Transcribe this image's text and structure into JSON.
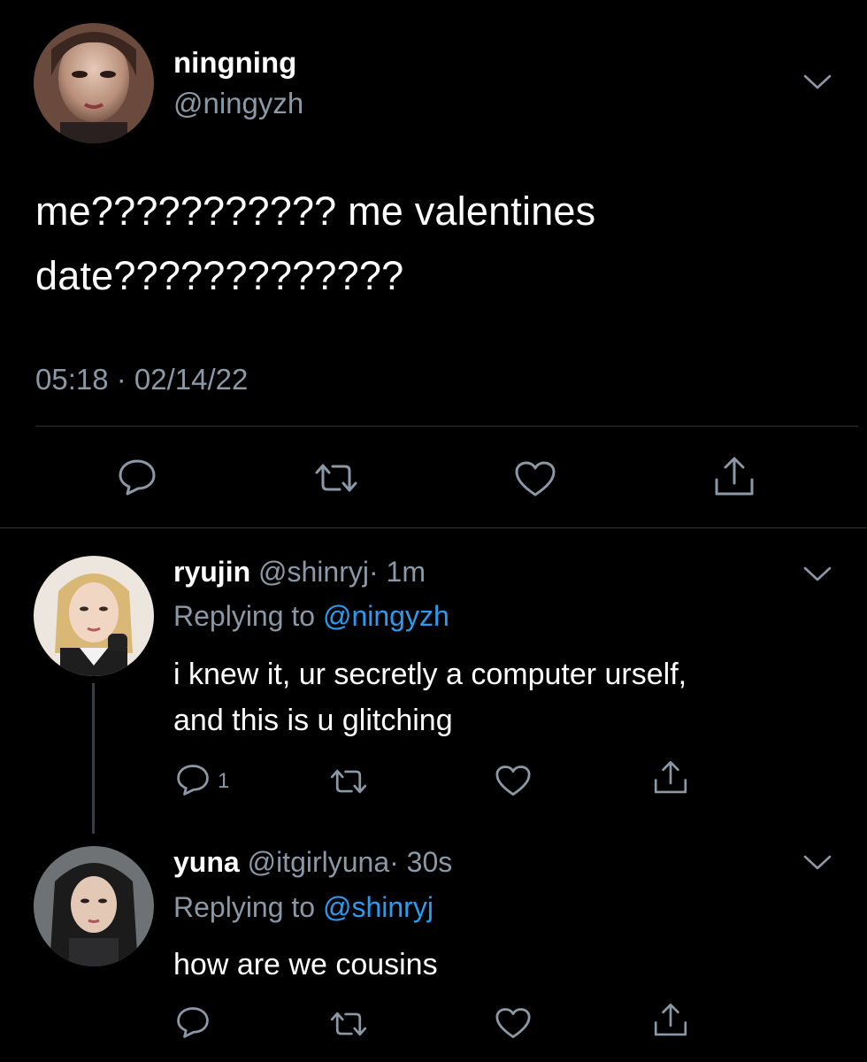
{
  "main_tweet": {
    "display_name": "ningning",
    "handle": "@ningyzh",
    "text_line1": "me??????????? me valentines",
    "text_line2": "date?????????????",
    "timestamp": "05:18 · 02/14/22"
  },
  "replies": [
    {
      "display_name": "ryujin",
      "handle": "@shinryj",
      "time": "· 1m",
      "replying_prefix": "Replying to ",
      "replying_to": "@ningyzh",
      "text_line1": "i knew it, ur secretly a computer urself,",
      "text_line2": "and this is u glitching",
      "reply_count": "1"
    },
    {
      "display_name": "yuna",
      "handle": "@itgirlyuna",
      "time": "· 30s",
      "replying_prefix": "Replying to ",
      "replying_to": "@shinryj",
      "text_line1": "how are we cousins"
    }
  ],
  "icons": {
    "reply": "speech-bubble-icon",
    "retweet": "retweet-icon",
    "like": "heart-icon",
    "share": "share-icon",
    "menu": "chevron-down-icon"
  },
  "colors": {
    "background": "#000000",
    "text": "#ffffff",
    "secondary": "#8b98a5",
    "link": "#2b9bf0",
    "divider": "#2f3336"
  }
}
